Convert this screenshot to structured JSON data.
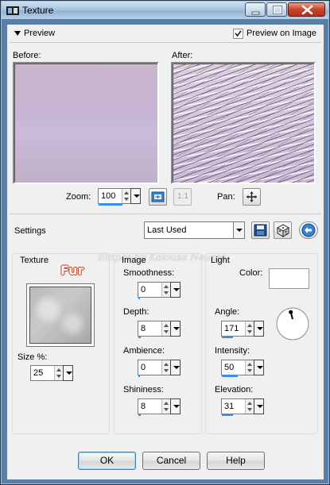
{
  "window": {
    "title": "Texture"
  },
  "preview_section": {
    "toggle_label": "Preview",
    "preview_on_image_label": "Preview on Image",
    "preview_on_image_checked": true,
    "before_label": "Before:",
    "after_label": "After:",
    "zoom_label": "Zoom:",
    "zoom_value": "100",
    "zoom_level_fraction": 0.55,
    "actual_size_label": "1:1",
    "pan_label": "Pan:"
  },
  "settings_row": {
    "label": "Settings",
    "preset_value": "Last Used"
  },
  "watermark": "Eltipas by Kalousa Nousse",
  "texture_panel": {
    "title": "Texture",
    "texture_name": "Fur",
    "size_label": "Size %:",
    "size_value": "25"
  },
  "image_panel": {
    "title": "Image",
    "smoothness_label": "Smoothness:",
    "smoothness_value": "0",
    "smoothness_fraction": 0.0,
    "depth_label": "Depth:",
    "depth_value": "8",
    "depth_fraction": 0.08,
    "ambience_label": "Ambience:",
    "ambience_value": "0",
    "ambience_fraction": 0.0,
    "shininess_label": "Shininess:",
    "shininess_value": "8",
    "shininess_fraction": 0.08
  },
  "light_panel": {
    "title": "Light",
    "color_label": "Color:",
    "color_value": "#ffffff",
    "angle_label": "Angle:",
    "angle_value": "171",
    "angle_degrees": 171,
    "intensity_label": "Intensity:",
    "intensity_value": "50",
    "intensity_fraction": 0.5,
    "elevation_label": "Elevation:",
    "elevation_value": "31",
    "elevation_fraction": 0.34
  },
  "buttons": {
    "ok": "OK",
    "cancel": "Cancel",
    "help": "Help"
  }
}
